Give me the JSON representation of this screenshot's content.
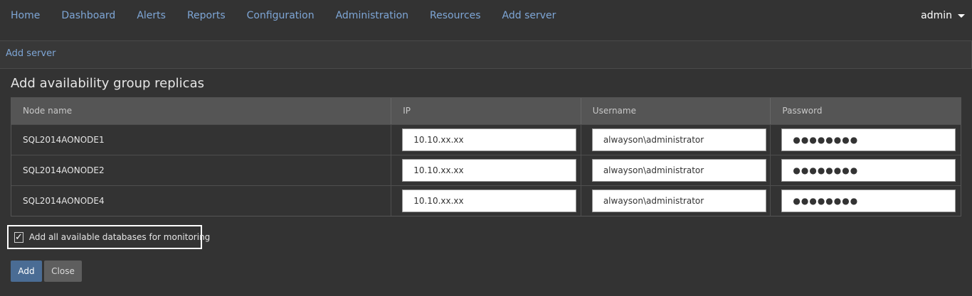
{
  "nav": {
    "items": [
      "Home",
      "Dashboard",
      "Alerts",
      "Reports",
      "Configuration",
      "Administration",
      "Resources",
      "Add server"
    ],
    "user": "admin"
  },
  "breadcrumb": {
    "label": "Add server"
  },
  "section": {
    "title": "Add availability group replicas"
  },
  "table": {
    "headers": [
      "Node name",
      "IP",
      "Username",
      "Password"
    ],
    "rows": [
      {
        "node": "SQL2014AONODE1",
        "ip": "10.10.xx.xx",
        "username": "alwayson\\administrator",
        "password": "●●●●●●●●"
      },
      {
        "node": "SQL2014AONODE2",
        "ip": "10.10.xx.xx",
        "username": "alwayson\\administrator",
        "password": "●●●●●●●●"
      },
      {
        "node": "SQL2014AONODE4",
        "ip": "10.10.xx.xx",
        "username": "alwayson\\administrator",
        "password": "●●●●●●●●"
      }
    ]
  },
  "checkbox": {
    "label": "Add all available databases for monitoring",
    "checked": true,
    "mark": "✓"
  },
  "buttons": {
    "add": "Add",
    "close": "Close"
  }
}
